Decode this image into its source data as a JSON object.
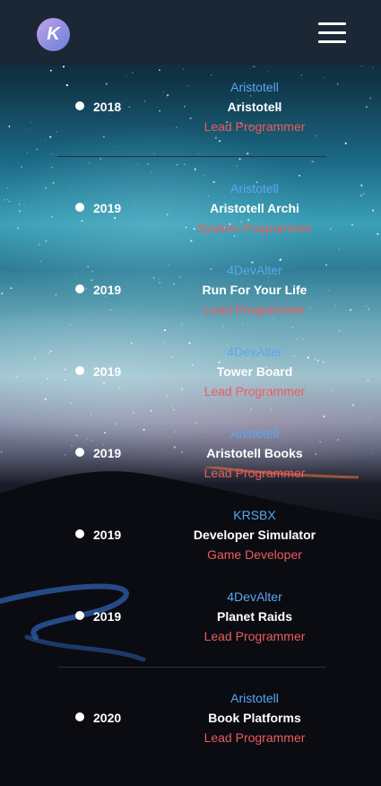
{
  "header": {
    "logo_letter": "K",
    "menu_icon": "hamburger-menu-icon"
  },
  "colors": {
    "header_bg": "#1b2735",
    "company": "#5aa7f0",
    "role": "#ec5c5c",
    "text": "#ffffff"
  },
  "entries": [
    {
      "year": "2018",
      "company": "Aristotell",
      "title": "Aristotell",
      "role": "Lead Programmer"
    },
    {
      "year": "2019",
      "company": "Aristotell",
      "title": "Aristotell Archi",
      "role": "System Programmer"
    },
    {
      "year": "2019",
      "company": "4DevAlter",
      "title": "Run For Your Life",
      "role": "Lead Programmer"
    },
    {
      "year": "2019",
      "company": "4DevAlter",
      "title": "Tower Board",
      "role": "Lead Programmer"
    },
    {
      "year": "2019",
      "company": "Aristotell",
      "title": "Aristotell Books",
      "role": "Lead Programmer"
    },
    {
      "year": "2019",
      "company": "KRSBX",
      "title": "Developer Simulator",
      "role": "Game Developer"
    },
    {
      "year": "2019",
      "company": "4DevAlter",
      "title": "Planet Raids",
      "role": "Lead Programmer"
    },
    {
      "year": "2020",
      "company": "Aristotell",
      "title": "Book Platforms",
      "role": "Lead Programmer"
    }
  ]
}
